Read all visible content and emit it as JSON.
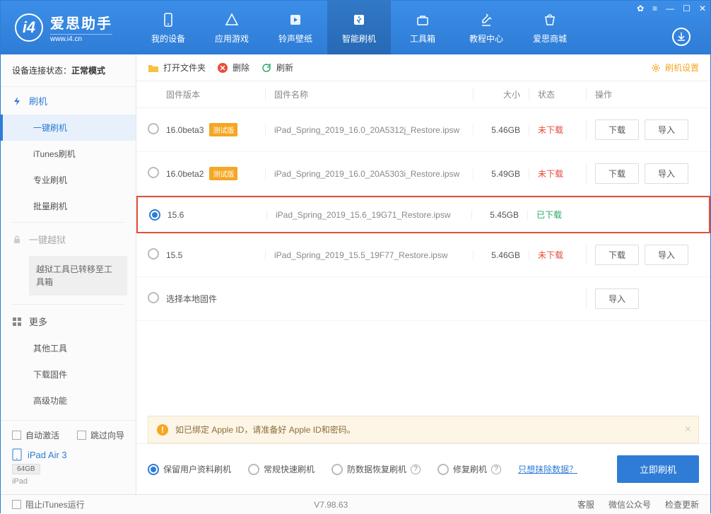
{
  "app": {
    "name": "爱思助手",
    "site": "www.i4.cn"
  },
  "topTabs": [
    {
      "label": "我的设备"
    },
    {
      "label": "应用游戏"
    },
    {
      "label": "铃声壁纸"
    },
    {
      "label": "智能刷机"
    },
    {
      "label": "工具箱"
    },
    {
      "label": "教程中心"
    },
    {
      "label": "爱思商城"
    }
  ],
  "connStatus": {
    "label": "设备连接状态：",
    "value": "正常模式"
  },
  "sidebar": {
    "flash": {
      "title": "刷机",
      "items": [
        {
          "label": "一键刷机"
        },
        {
          "label": "iTunes刷机"
        },
        {
          "label": "专业刷机"
        },
        {
          "label": "批量刷机"
        }
      ]
    },
    "jailbreak": {
      "title": "一键越狱",
      "note": "越狱工具已转移至工具箱"
    },
    "more": {
      "title": "更多",
      "items": [
        {
          "label": "其他工具"
        },
        {
          "label": "下载固件"
        },
        {
          "label": "高级功能"
        }
      ]
    },
    "autoActivate": "自动激活",
    "skipGuide": "跳过向导",
    "device": {
      "name": "iPad Air 3",
      "storage": "64GB",
      "type": "iPad"
    }
  },
  "toolbar": {
    "openFolder": "打开文件夹",
    "delete": "删除",
    "refresh": "刷新",
    "settings": "刷机设置"
  },
  "columns": {
    "ver": "固件版本",
    "name": "固件名称",
    "size": "大小",
    "status": "状态",
    "ops": "操作"
  },
  "rows": [
    {
      "ver": "16.0beta3",
      "beta": "测试版",
      "name": "iPad_Spring_2019_16.0_20A5312j_Restore.ipsw",
      "size": "5.46GB",
      "status": "未下载",
      "statusClass": "nd",
      "download": "下载",
      "import": "导入",
      "selected": false,
      "showOps": true
    },
    {
      "ver": "16.0beta2",
      "beta": "测试版",
      "name": "iPad_Spring_2019_16.0_20A5303i_Restore.ipsw",
      "size": "5.49GB",
      "status": "未下载",
      "statusClass": "nd",
      "download": "下载",
      "import": "导入",
      "selected": false,
      "showOps": true
    },
    {
      "ver": "15.6",
      "beta": "",
      "name": "iPad_Spring_2019_15.6_19G71_Restore.ipsw",
      "size": "5.45GB",
      "status": "已下载",
      "statusClass": "dl",
      "download": "",
      "import": "",
      "selected": true,
      "showOps": false,
      "highlighted": true
    },
    {
      "ver": "15.5",
      "beta": "",
      "name": "iPad_Spring_2019_15.5_19F77_Restore.ipsw",
      "size": "5.46GB",
      "status": "未下载",
      "statusClass": "nd",
      "download": "下载",
      "import": "导入",
      "selected": false,
      "showOps": true
    },
    {
      "ver": "选择本地固件",
      "beta": "",
      "name": "",
      "size": "",
      "status": "",
      "statusClass": "",
      "download": "",
      "import": "导入",
      "selected": false,
      "showOps": true,
      "localOnly": true
    }
  ],
  "info": "如已绑定 Apple ID，请准备好 Apple ID和密码。",
  "options": [
    {
      "label": "保留用户资料刷机",
      "selected": true
    },
    {
      "label": "常规快速刷机",
      "selected": false
    },
    {
      "label": "防数据恢复刷机",
      "selected": false,
      "help": true
    },
    {
      "label": "修复刷机",
      "selected": false,
      "help": true
    }
  ],
  "eraseLink": "只想抹除数据？",
  "actionBtn": "立即刷机",
  "footer": {
    "blockItunes": "阻止iTunes运行",
    "version": "V7.98.63",
    "links": [
      "客服",
      "微信公众号",
      "检查更新"
    ]
  }
}
